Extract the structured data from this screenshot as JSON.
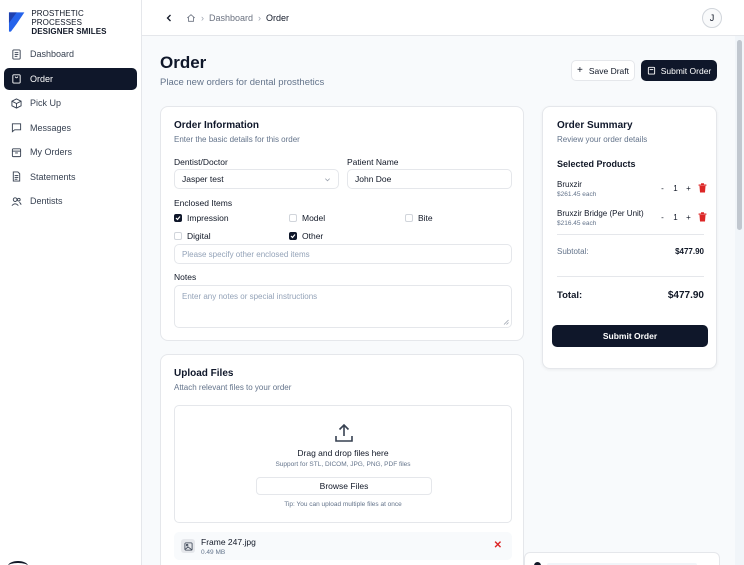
{
  "brand": {
    "line1": "PROSTHETIC PROCESSES",
    "line2": "DESIGNER SMILES",
    "logo_color": "#2563eb"
  },
  "sidebar": {
    "items": [
      {
        "label": "Dashboard",
        "icon": "document-icon",
        "active": false
      },
      {
        "label": "Order",
        "icon": "shopping-bag-icon",
        "active": true
      },
      {
        "label": "Pick Up",
        "icon": "box-icon",
        "active": false
      },
      {
        "label": "Messages",
        "icon": "message-icon",
        "active": false
      },
      {
        "label": "My Orders",
        "icon": "inbox-icon",
        "active": false
      },
      {
        "label": "Statements",
        "icon": "file-text-icon",
        "active": false
      },
      {
        "label": "Dentists",
        "icon": "users-icon",
        "active": false
      }
    ]
  },
  "topbar": {
    "breadcrumb": [
      "Dashboard",
      "Order"
    ],
    "avatar_initial": "J"
  },
  "header": {
    "title": "Order",
    "subtitle": "Place new orders for dental prosthetics",
    "save_draft_label": "Save Draft",
    "submit_label": "Submit Order"
  },
  "order_info": {
    "title": "Order Information",
    "subtitle": "Enter the basic details for this order",
    "dentist_label": "Dentist/Doctor",
    "dentist_value": "Jasper test",
    "patient_label": "Patient Name",
    "patient_value": "John Doe",
    "enclosed_label": "Enclosed Items",
    "enclosed_items": [
      {
        "label": "Impression",
        "checked": true
      },
      {
        "label": "Model",
        "checked": false
      },
      {
        "label": "Bite",
        "checked": false
      },
      {
        "label": "Digital",
        "checked": false
      },
      {
        "label": "Other",
        "checked": true
      }
    ],
    "other_placeholder": "Please specify other enclosed items",
    "notes_label": "Notes",
    "notes_placeholder": "Enter any notes or special instructions"
  },
  "upload": {
    "title": "Upload Files",
    "subtitle": "Attach relevant files to your order",
    "drop_title": "Drag and drop files here",
    "drop_sub": "Support for STL, DICOM, JPG, PNG, PDF files",
    "browse_label": "Browse Files",
    "tip": "Tip: You can upload multiple files at once",
    "files": [
      {
        "name": "Frame 247.jpg",
        "size": "0.49 MB"
      }
    ]
  },
  "summary": {
    "title": "Order Summary",
    "subtitle": "Review your order details",
    "section_label": "Selected Products",
    "products": [
      {
        "name": "Bruxzir",
        "price": "$261.45 each",
        "qty": "1"
      },
      {
        "name": "Bruxzir Bridge (Per Unit)",
        "price": "$216.45 each",
        "qty": "1"
      }
    ],
    "subtotal_label": "Subtotal:",
    "subtotal_value": "$477.90",
    "total_label": "Total:",
    "total_value": "$477.90",
    "submit_label": "Submit Order"
  },
  "colors": {
    "primary": "#0f172a",
    "danger": "#dc2626",
    "brand_blue": "#2563eb"
  }
}
